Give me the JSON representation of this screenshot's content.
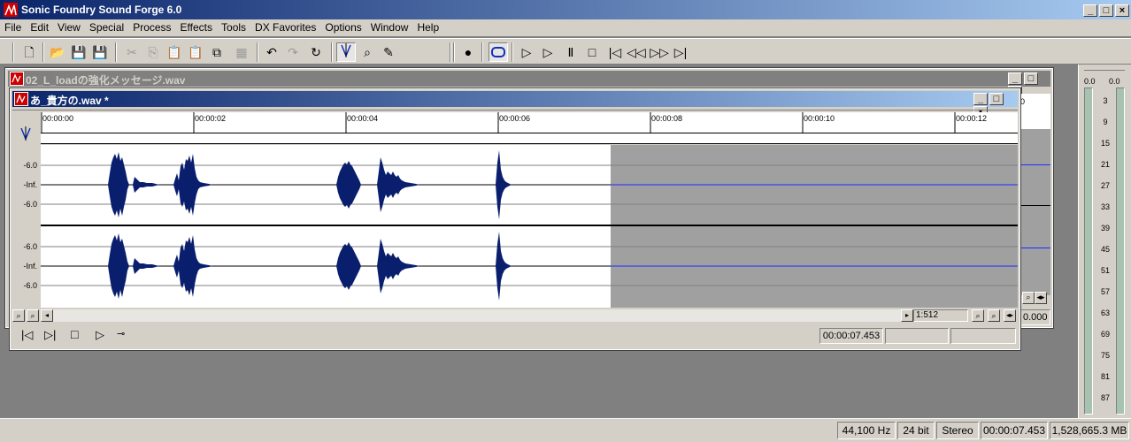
{
  "app": {
    "title": "Sonic Foundry Sound Forge 6.0"
  },
  "menu": [
    "File",
    "Edit",
    "View",
    "Special",
    "Process",
    "Effects",
    "Tools",
    "DX Favorites",
    "Options",
    "Window",
    "Help"
  ],
  "back_window": {
    "title": "02_L_loadの強化メッセージ.wav",
    "ruler_fragment": "0",
    "zoom_value": "0.000"
  },
  "front_window": {
    "title": "あ_貴方の.wav *",
    "ruler_labels": [
      "00:00:00",
      "00:00:02",
      "00:00:04",
      "00:00:06",
      "00:00:08",
      "00:00:10",
      "00:00:12"
    ],
    "channel_scale": [
      "-6.0",
      "-Inf.",
      "-6.0"
    ],
    "zoom_ratio": "1:512",
    "position": "00:00:07.453"
  },
  "status": {
    "sample_rate": "44,100 Hz",
    "bit_depth": "24 bit",
    "channels": "Stereo",
    "length": "00:00:07.453",
    "size": "1,528,665.3 MB"
  },
  "meters": {
    "peak_left": "0.0",
    "peak_right": "0.0",
    "scale": [
      "3",
      "9",
      "15",
      "21",
      "27",
      "33",
      "39",
      "45",
      "51",
      "57",
      "63",
      "69",
      "75",
      "81",
      "87"
    ]
  },
  "colors": {
    "titlebar_active_start": "#0a246a",
    "titlebar_active_end": "#a6caf0",
    "titlebar_inactive": "#808080",
    "waveform": "#0a1e6e",
    "empty_region": "#a0a0a0",
    "centerline": "#1e2cff"
  }
}
